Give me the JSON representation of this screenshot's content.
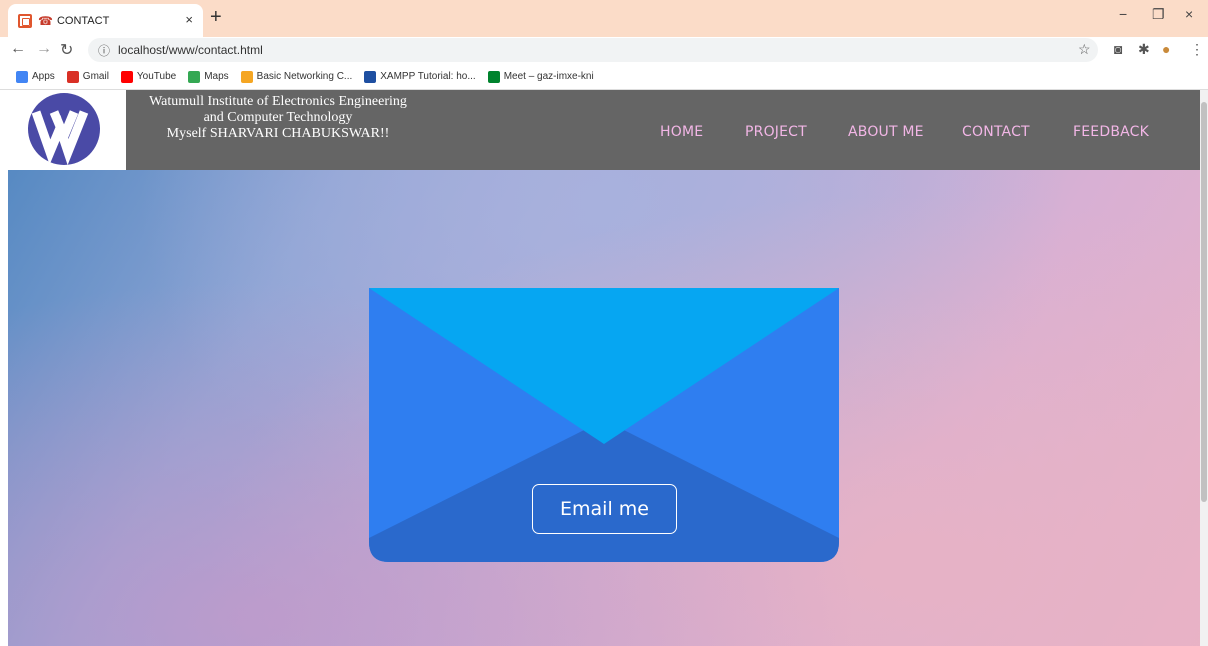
{
  "browser": {
    "tab_title": "CONTACT",
    "tab_close": "×",
    "new_tab": "+",
    "url": "localhost/www/contact.html",
    "window_controls": {
      "minimize": "−",
      "restore": "❐",
      "close": "×"
    },
    "bookmarks": [
      {
        "label": "Apps",
        "icon": "apps-grid-icon",
        "color": "#4285f4"
      },
      {
        "label": "Gmail",
        "icon": "gmail-icon",
        "color": "#d93025"
      },
      {
        "label": "YouTube",
        "icon": "youtube-icon",
        "color": "#ff0000"
      },
      {
        "label": "Maps",
        "icon": "maps-icon",
        "color": "#34a853"
      },
      {
        "label": "Basic Networking C...",
        "icon": "networking-icon",
        "color": "#f5a623"
      },
      {
        "label": "XAMPP Tutorial: ho...",
        "icon": "xampp-icon",
        "color": "#1e4fa1"
      },
      {
        "label": "Meet – gaz-imxe-kni",
        "icon": "meet-icon",
        "color": "#00832d"
      }
    ]
  },
  "header": {
    "logo_letter": "W",
    "institute_line1": "Watumull Institute of Electronics Engineering",
    "institute_line2": "and Computer Technology",
    "institute_line3": "Myself SHARVARI CHABUKSWAR!!",
    "nav": [
      "HOME",
      "PROJECT",
      "ABOUT ME",
      "CONTACT",
      "FEEDBACK"
    ]
  },
  "main": {
    "email_button": "Email me"
  },
  "colors": {
    "header_bg": "#656565",
    "nav_text": "#f2b6e6",
    "envelope_body": "#2f7ef0",
    "envelope_flap": "#06a6f2",
    "envelope_bottom": "#2a69cc",
    "logo_circle": "#4a4aa6"
  }
}
